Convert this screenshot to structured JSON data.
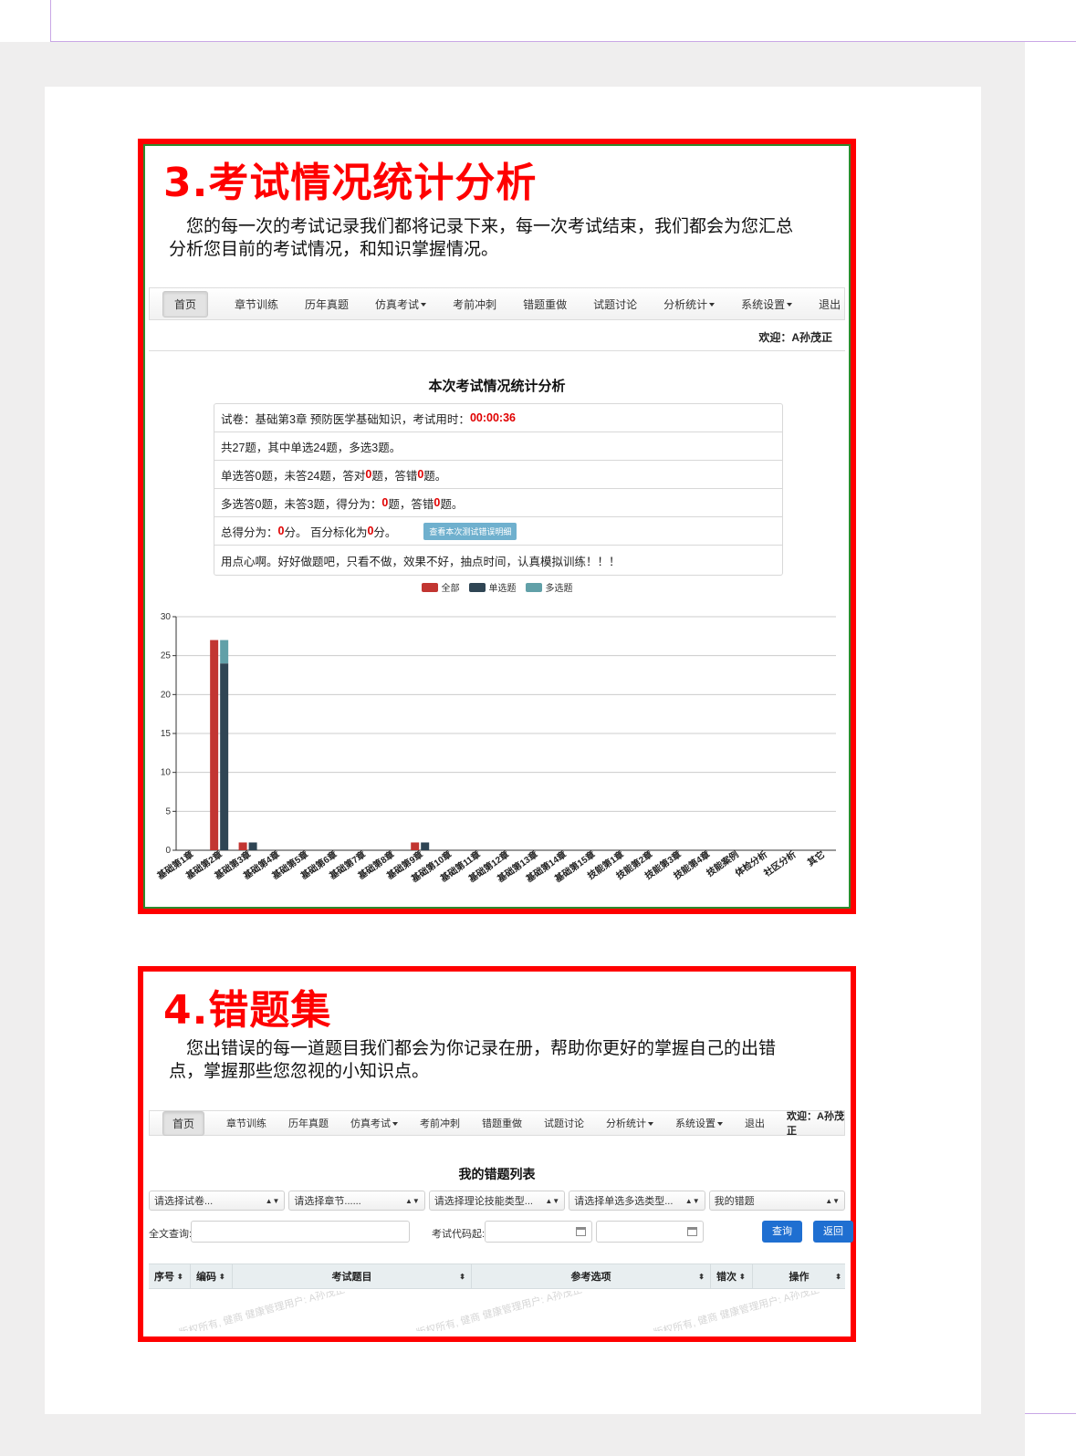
{
  "section3": {
    "title": "3.考试情况统计分析",
    "desc": "您的每一次的考试记录我们都将记录下来，每一次考试结束，我们都会为您汇总分析您目前的考试情况，和知识掌握情况。",
    "nav": {
      "items": [
        "首页",
        "章节训练",
        "历年真题",
        "仿真考试",
        "考前冲刺",
        "错题重做",
        "试题讨论",
        "分析统计",
        "系统设置",
        "退出"
      ],
      "welcome": "欢迎：A孙茂正"
    },
    "stats_title": "本次考试情况统计分析",
    "row1_prefix": "试卷：基础第3章 预防医学基础知识，考试用时：",
    "row1_time": "00:00:36",
    "row2": "共27题，其中单选24题，多选3题。",
    "row3_a": "单选答0题，未答24题，答对 ",
    "row3_v1": "0",
    "row3_b": " 题，答错",
    "row3_v2": "0",
    "row3_c": "题。",
    "row4_a": "多选答0题，未答3题，得分为： ",
    "row4_v1": "0",
    "row4_b": " 题，答错",
    "row4_v2": "0",
    "row4_c": "题。",
    "row5_a": "总得分为： ",
    "row5_v1": "0",
    "row5_b": " 分。 百分标化为",
    "row5_v2": "0",
    "row5_c": "分。",
    "row5_button": "查看本次测试错误明细",
    "row6": "用点心啊。好好做题吧，只看不做，效果不好，抽点时间，认真模拟训练！！！",
    "legend": [
      "全部",
      "单选题",
      "多选题"
    ],
    "colors": {
      "all": "#c23531",
      "single": "#2f4554",
      "multi": "#61a0a8"
    }
  },
  "chart_data": {
    "type": "bar",
    "ylim": [
      0,
      30
    ],
    "yticks": [
      0,
      5,
      10,
      15,
      20,
      25,
      30
    ],
    "categories": [
      "基础第1章",
      "基础第2章",
      "基础第3章",
      "基础第4章",
      "基础第5章",
      "基础第6章",
      "基础第7章",
      "基础第8章",
      "基础第9章",
      "基础第10章",
      "基础第11章",
      "基础第12章",
      "基础第13章",
      "基础第14章",
      "基础第15章",
      "技能第1章",
      "技能第2章",
      "技能第3章",
      "技能第4章",
      "技能案例",
      "体检分析",
      "社区分析",
      "其它"
    ],
    "series": [
      {
        "name": "全部",
        "values": [
          0,
          27,
          1,
          0,
          0,
          0,
          0,
          0,
          1,
          0,
          0,
          0,
          0,
          0,
          0,
          0,
          0,
          0,
          0,
          0,
          0,
          0,
          0
        ]
      },
      {
        "name": "单选题",
        "values": [
          0,
          24,
          1,
          0,
          0,
          0,
          0,
          0,
          1,
          0,
          0,
          0,
          0,
          0,
          0,
          0,
          0,
          0,
          0,
          0,
          0,
          0,
          0
        ]
      },
      {
        "name": "多选题",
        "values": [
          0,
          3,
          0,
          0,
          0,
          0,
          0,
          0,
          0,
          0,
          0,
          0,
          0,
          0,
          0,
          0,
          0,
          0,
          0,
          0,
          0,
          0,
          0
        ]
      }
    ]
  },
  "section4": {
    "title": "4.错题集",
    "desc": "您出错误的每一道题目我们都会为你记录在册，帮助你更好的掌握自己的出错点，掌握那些您忽视的小知识点。",
    "nav": {
      "items": [
        "首页",
        "章节训练",
        "历年真题",
        "仿真考试",
        "考前冲刺",
        "错题重做",
        "试题讨论",
        "分析统计",
        "系统设置",
        "退出"
      ],
      "welcome": "欢迎：A孙茂正"
    },
    "list_title": "我的错题列表",
    "selects": [
      "请选择试卷...",
      "请选择章节......",
      "请选择理论技能类型...",
      "请选择单选多选类型...",
      "我的错题"
    ],
    "fulltext_label": "全文查询:",
    "code_label": "考试代码起:",
    "search_button": "查询",
    "back_button": "返回",
    "columns": [
      "序号",
      "编码",
      "考试题目",
      "参考选项",
      "错次",
      "操作"
    ]
  },
  "watermark": "版权所有, 健商 健康管理用户: A孙茂正"
}
